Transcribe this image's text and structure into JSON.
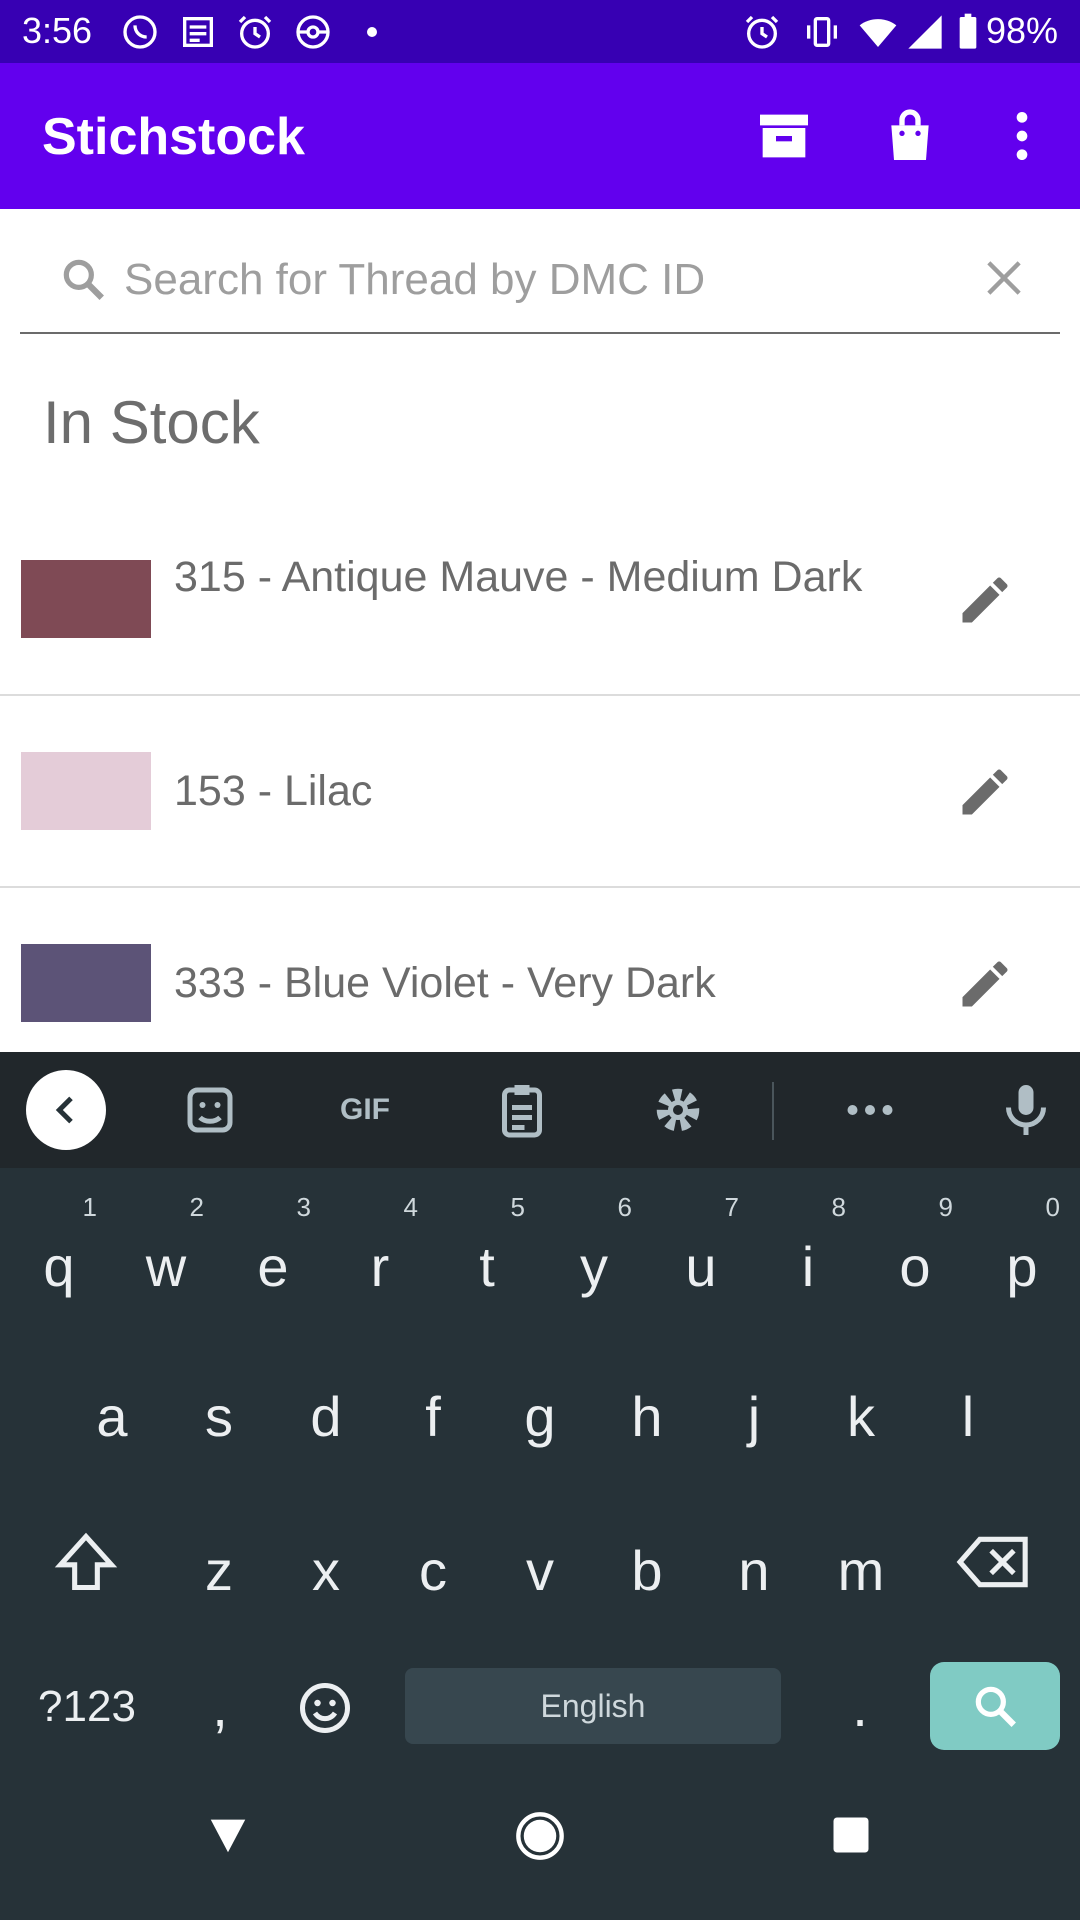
{
  "status_bar": {
    "time": "3:56",
    "battery": "98%"
  },
  "app_bar": {
    "title": "Stichstock",
    "icons": [
      "archive-icon",
      "shopping-bag-icon",
      "more-vert-icon"
    ]
  },
  "search": {
    "placeholder": "Search for Thread by DMC ID",
    "value": ""
  },
  "section_title": "In Stock",
  "threads": [
    {
      "label": "315 - Antique Mauve - Medium Dark",
      "color": "#7f4a55"
    },
    {
      "label": "153 - Lilac",
      "color": "#e4ccd8"
    },
    {
      "label": "333 - Blue Violet - Very Dark",
      "color": "#5c5377"
    }
  ],
  "keyboard": {
    "toolbar": {
      "gif": "GIF"
    },
    "row1": [
      "q",
      "w",
      "e",
      "r",
      "t",
      "y",
      "u",
      "i",
      "o",
      "p"
    ],
    "row1_hints": [
      "1",
      "2",
      "3",
      "4",
      "5",
      "6",
      "7",
      "8",
      "9",
      "0"
    ],
    "row2": [
      "a",
      "s",
      "d",
      "f",
      "g",
      "h",
      "j",
      "k",
      "l"
    ],
    "row3": [
      "z",
      "x",
      "c",
      "v",
      "b",
      "n",
      "m"
    ],
    "symbols": "?123",
    "comma": ",",
    "period": ".",
    "space": "English",
    "accent_color": "#80cbc4"
  }
}
